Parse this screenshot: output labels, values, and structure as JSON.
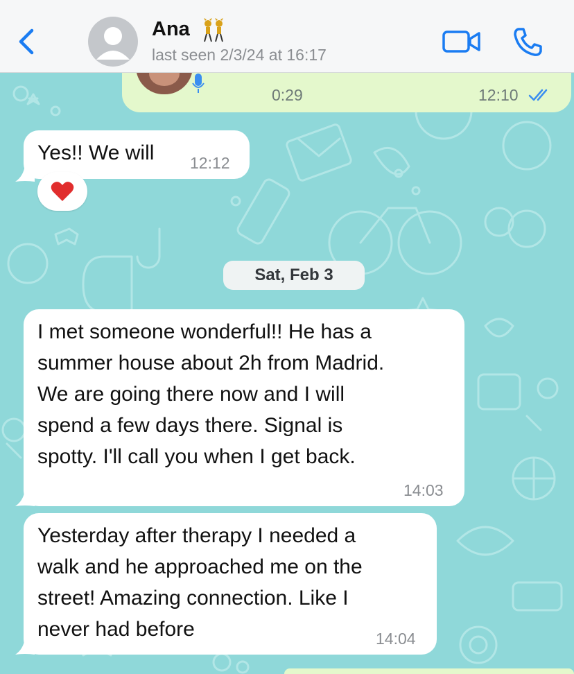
{
  "header": {
    "contact_name": "Ana",
    "contact_emoji": "👯",
    "last_seen": "last seen 2/3/24 at 16:17",
    "icons": [
      "back-icon",
      "avatar-placeholder",
      "video-call-icon",
      "phone-icon"
    ]
  },
  "messages": [
    {
      "type": "voice",
      "direction": "sent",
      "duration": "0:29",
      "time": "12:10",
      "status": "read"
    },
    {
      "type": "text",
      "direction": "received",
      "text": "Yes!! We will",
      "time": "12:12",
      "reaction": "❤️"
    },
    {
      "type": "date",
      "text": "Sat, Feb 3"
    },
    {
      "type": "text",
      "direction": "received",
      "text": "I met someone wonderful!! He has a\nsummer house about 2h from Madrid.\nWe are going there now and I will\nspend a few days there. Signal is\nspotty. I'll call you when I get back.",
      "time": "14:03"
    },
    {
      "type": "text",
      "direction": "received",
      "text": "Yesterday after therapy I needed a\nwalk and he approached me on the\nstreet! Amazing connection. Like I\nnever had before",
      "time": "14:04"
    }
  ],
  "colors": {
    "wallpaper": "#8fd8d9",
    "accent": "#1a7cf2",
    "sent_bubble": "#e4f8cc",
    "received_bubble": "#ffffff",
    "read_ticks": "#3a8ef0"
  }
}
